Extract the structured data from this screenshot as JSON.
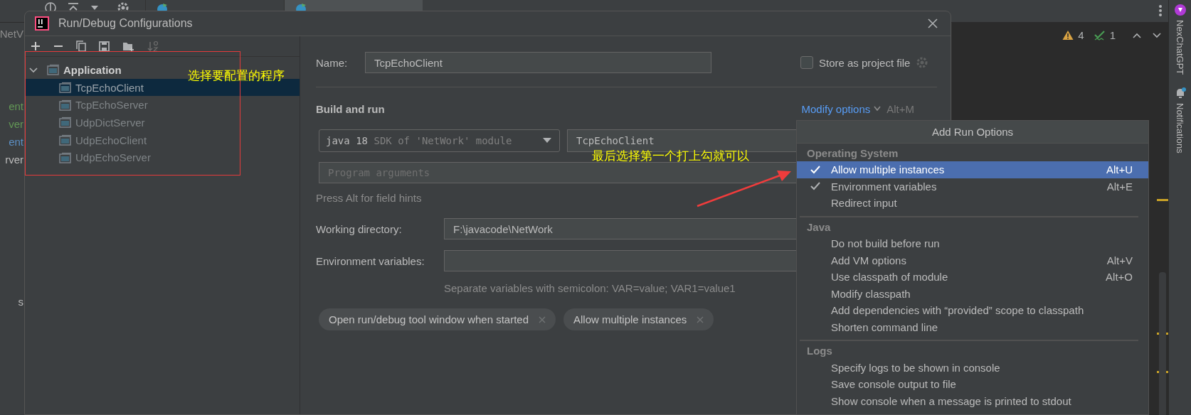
{
  "ide": {
    "left_fragments": [
      {
        "text": "NetV",
        "color": "#8c8c8c"
      },
      {
        "text": "ent",
        "color": "#629755"
      },
      {
        "text": "ver",
        "color": "#629755"
      },
      {
        "text": "ent",
        "color": "#5c8fc4"
      },
      {
        "text": "rver",
        "color": "#bbbbbb"
      },
      {
        "text": "s",
        "color": "#bbbbbb"
      }
    ],
    "inspections": [
      {
        "kind": "warning",
        "count": "4"
      },
      {
        "kind": "typo",
        "count": "1"
      }
    ],
    "side_tools": [
      {
        "kind": "chat",
        "label": "NexChatGPT"
      },
      {
        "kind": "bell",
        "label": "Notifications"
      }
    ]
  },
  "dialog": {
    "title": "Run/Debug Configurations",
    "tree": {
      "label": "Application",
      "expanded": true,
      "children": [
        {
          "label": "TcpEchoClient",
          "selected": true
        },
        {
          "label": "TcpEchoServer",
          "selected": false
        },
        {
          "label": "UdpDictServer",
          "selected": false
        },
        {
          "label": "UdpEchoClient",
          "selected": false
        },
        {
          "label": "UdpEchoServer",
          "selected": false
        }
      ]
    },
    "name_label": "Name:",
    "name_value": "TcpEchoClient",
    "store_label": "Store as project file",
    "store_checked": false,
    "section": "Build and run",
    "modify_link": "Modify options",
    "modify_shortcut": "Alt+M",
    "jre": {
      "version": "java 18",
      "detail": "SDK of 'NetWork' module"
    },
    "main_class": "TcpEchoClient",
    "args_placeholder": "Program arguments",
    "hint": "Press Alt for field hints",
    "workdir_label": "Working directory:",
    "workdir_value": "F:\\javacode\\NetWork",
    "env_label": "Environment variables:",
    "env_hint": "Separate variables with semicolon: VAR=value; VAR1=value1",
    "chips": [
      "Open run/debug tool window when started",
      "Allow multiple instances"
    ]
  },
  "popup": {
    "title": "Add Run Options",
    "sections": [
      {
        "title": "Operating System",
        "items": [
          {
            "label": "Allow multiple instances",
            "shortcut": "Alt+U",
            "checked": true,
            "selected": true
          },
          {
            "label": "Environment variables",
            "shortcut": "Alt+E",
            "checked": true,
            "selected": false
          },
          {
            "label": "Redirect input",
            "checked": false,
            "selected": false
          }
        ]
      },
      {
        "title": "Java",
        "items": [
          {
            "label": "Do not build before run",
            "checked": false,
            "selected": false
          },
          {
            "label": "Add VM options",
            "shortcut": "Alt+V",
            "checked": false,
            "selected": false
          },
          {
            "label": "Use classpath of module",
            "shortcut": "Alt+O",
            "checked": false,
            "selected": false
          },
          {
            "label": "Modify classpath",
            "checked": false,
            "selected": false
          },
          {
            "label": "Add dependencies with “provided” scope to classpath",
            "checked": false,
            "selected": false
          },
          {
            "label": "Shorten command line",
            "checked": false,
            "selected": false
          }
        ]
      },
      {
        "title": "Logs",
        "items": [
          {
            "label": "Specify logs to be shown in console",
            "checked": false,
            "selected": false
          },
          {
            "label": "Save console output to file",
            "checked": false,
            "selected": false
          },
          {
            "label": "Show console when a message is printed to stdout",
            "checked": false,
            "selected": false
          }
        ]
      }
    ]
  },
  "annotations": [
    {
      "kind": "frame-note",
      "text": "选择要配置的程序"
    },
    {
      "kind": "arrow-note",
      "text": "最后选择第一个打上勾就可以"
    }
  ]
}
